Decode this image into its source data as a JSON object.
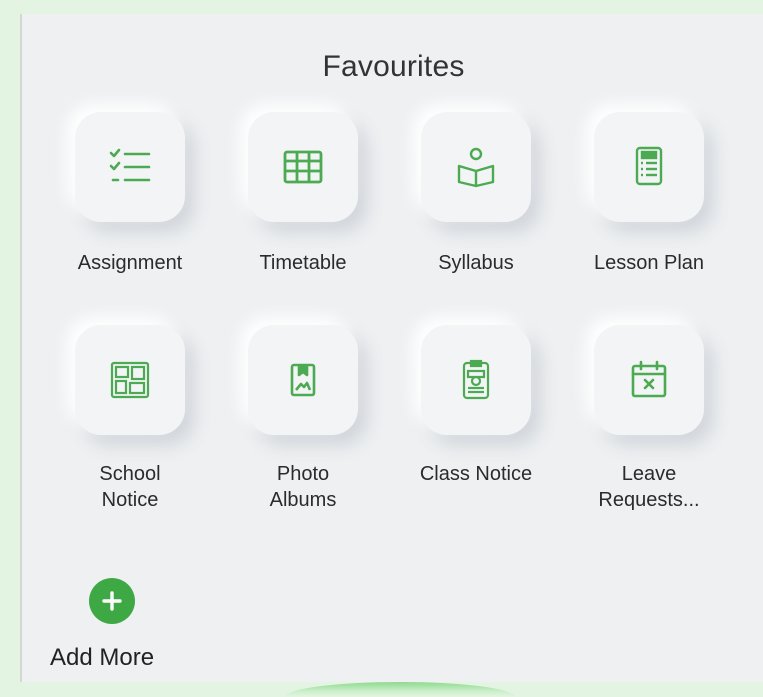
{
  "section": {
    "title": "Favourites"
  },
  "favourites": [
    {
      "label": "Assignment",
      "icon": "checklist-icon"
    },
    {
      "label": "Timetable",
      "icon": "grid-table-icon"
    },
    {
      "label": "Syllabus",
      "icon": "person-book-icon"
    },
    {
      "label": "Lesson Plan",
      "icon": "document-list-icon"
    },
    {
      "label_line1": "School",
      "label_line2": "Notice",
      "icon": "bulletin-board-icon"
    },
    {
      "label_line1": "Photo",
      "label_line2": "Albums",
      "icon": "photo-album-icon"
    },
    {
      "label": "Class Notice",
      "icon": "clipboard-icon"
    },
    {
      "label_line1": "Leave",
      "label_line2": "Requests...",
      "icon": "calendar-cancel-icon"
    }
  ],
  "add_more": {
    "label": "Add More",
    "icon": "plus-icon"
  },
  "colors": {
    "accent": "#3ea845",
    "icon": "#4caa52",
    "panel": "#eef0f2",
    "background": "#e4f4e2"
  }
}
